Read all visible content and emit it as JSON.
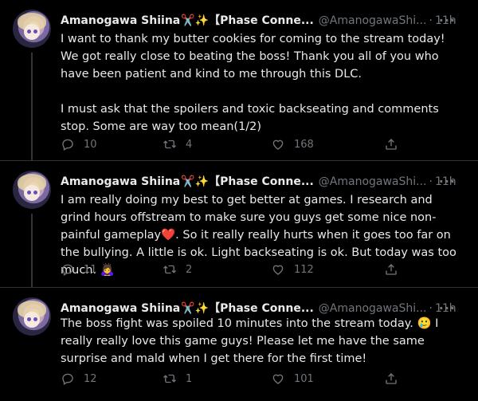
{
  "tweets": [
    {
      "name": "Amanogawa Shiina",
      "emoji_scissors": "✂️",
      "emoji_sparkle": "✨",
      "tag": "【Phase Conne...",
      "handle": "@AmanogawaShi...",
      "dot": "·",
      "time": "11h",
      "more": "···",
      "text": "I want to thank my butter cookies for coming to the stream today! We got really close to beating the boss! Thank you all of you who have been patient and kind to me through this DLC.\n\nI must ask that the spoilers and toxic backseating and comments stop. Some are way too mean(1/2)",
      "replies": "10",
      "retweets": "4",
      "likes": "168"
    },
    {
      "name": "Amanogawa Shiina",
      "emoji_scissors": "✂️",
      "emoji_sparkle": "✨",
      "tag": "【Phase Conne...",
      "handle": "@AmanogawaShi...",
      "dot": "·",
      "time": "11h",
      "more": "···",
      "text_a": "I am really doing my best to get better at games. I research and grind hours offstream to make sure you guys get some nice non-painful gameplay",
      "text_heart": "❤️",
      "text_b": ". So it really really hurts when it goes too far on the bullying. A little is ok. Light backseating is ok. But today was too much. ",
      "text_emoji": "🙇‍♀️",
      "replies": "11",
      "retweets": "2",
      "likes": "112"
    },
    {
      "name": "Amanogawa Shiina",
      "emoji_scissors": "✂️",
      "emoji_sparkle": "✨",
      "tag": "【Phase Conne...",
      "handle": "@AmanogawaShi...",
      "dot": "·",
      "time": "11h",
      "more": "···",
      "text_a": "The boss fight was spoiled 10 minutes into the stream today. ",
      "text_emoji": "🥲",
      "text_b": " I really really love this game guys! Please let me have the same surprise and mald when I get there for the first time!",
      "replies": "12",
      "retweets": "1",
      "likes": "101"
    }
  ],
  "icons": {
    "reply": "reply-icon",
    "retweet": "retweet-icon",
    "like": "like-icon",
    "share": "share-icon",
    "more": "more-icon"
  },
  "colors": {
    "background": "#000000",
    "text": "#e7e9ea",
    "muted": "#71767b",
    "divider": "#2f3336",
    "heart": "#f4212e"
  }
}
